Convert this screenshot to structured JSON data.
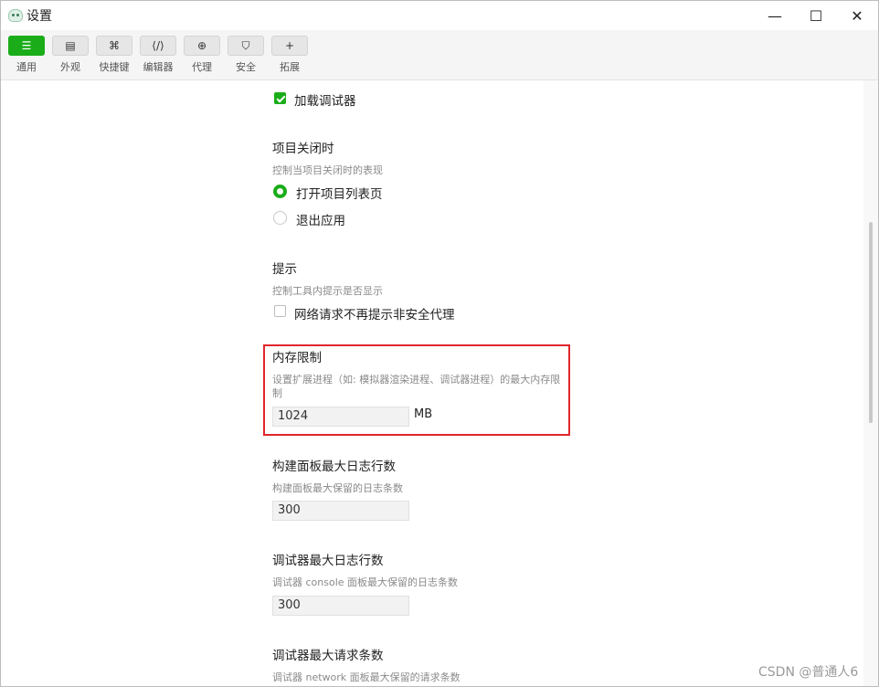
{
  "window": {
    "title": "设置",
    "controls": {
      "minimize": "—",
      "maximize": "☐",
      "close": "✕"
    }
  },
  "toolbar": {
    "items": [
      {
        "label": "通用",
        "icon": "sliders-icon",
        "glyph": "☰",
        "active": true
      },
      {
        "label": "外观",
        "icon": "window-layout-icon",
        "glyph": "▤",
        "active": false
      },
      {
        "label": "快捷键",
        "icon": "command-key-icon",
        "glyph": "⌘",
        "active": false
      },
      {
        "label": "编辑器",
        "icon": "code-icon",
        "glyph": "⟨/⟩",
        "active": false
      },
      {
        "label": "代理",
        "icon": "globe-icon",
        "glyph": "⊕",
        "active": false
      },
      {
        "label": "安全",
        "icon": "shield-icon",
        "glyph": "⛉",
        "active": false
      },
      {
        "label": "拓展",
        "icon": "plus-icon",
        "glyph": "+",
        "active": false
      }
    ]
  },
  "settings": {
    "load_debugger": {
      "label": "加载调试器",
      "checked": true
    },
    "project_close": {
      "title": "项目关闭时",
      "desc": "控制当项目关闭时的表现",
      "options": [
        {
          "label": "打开项目列表页",
          "selected": true
        },
        {
          "label": "退出应用",
          "selected": false
        }
      ]
    },
    "hints": {
      "title": "提示",
      "desc": "控制工具内提示是否显示",
      "option": {
        "label": "网络请求不再提示非安全代理",
        "checked": false
      }
    },
    "memory_limit": {
      "title": "内存限制",
      "desc_line1": "设置扩展进程（如: 模拟器渲染进程、调试器进程）的最大内存限",
      "desc_line2": "制",
      "value": "1024",
      "unit": "MB"
    },
    "build_log_lines": {
      "title": "构建面板最大日志行数",
      "desc": "构建面板最大保留的日志条数",
      "value": "300"
    },
    "debugger_log_lines": {
      "title": "调试器最大日志行数",
      "desc": "调试器 console 面板最大保留的日志条数",
      "value": "300"
    },
    "debugger_requests": {
      "title": "调试器最大请求条数",
      "desc": "调试器 network 面板最大保留的请求条数"
    }
  },
  "watermark": "CSDN @普通人6",
  "colors": {
    "accent": "#1aad19",
    "highlight": "#e0262b"
  }
}
